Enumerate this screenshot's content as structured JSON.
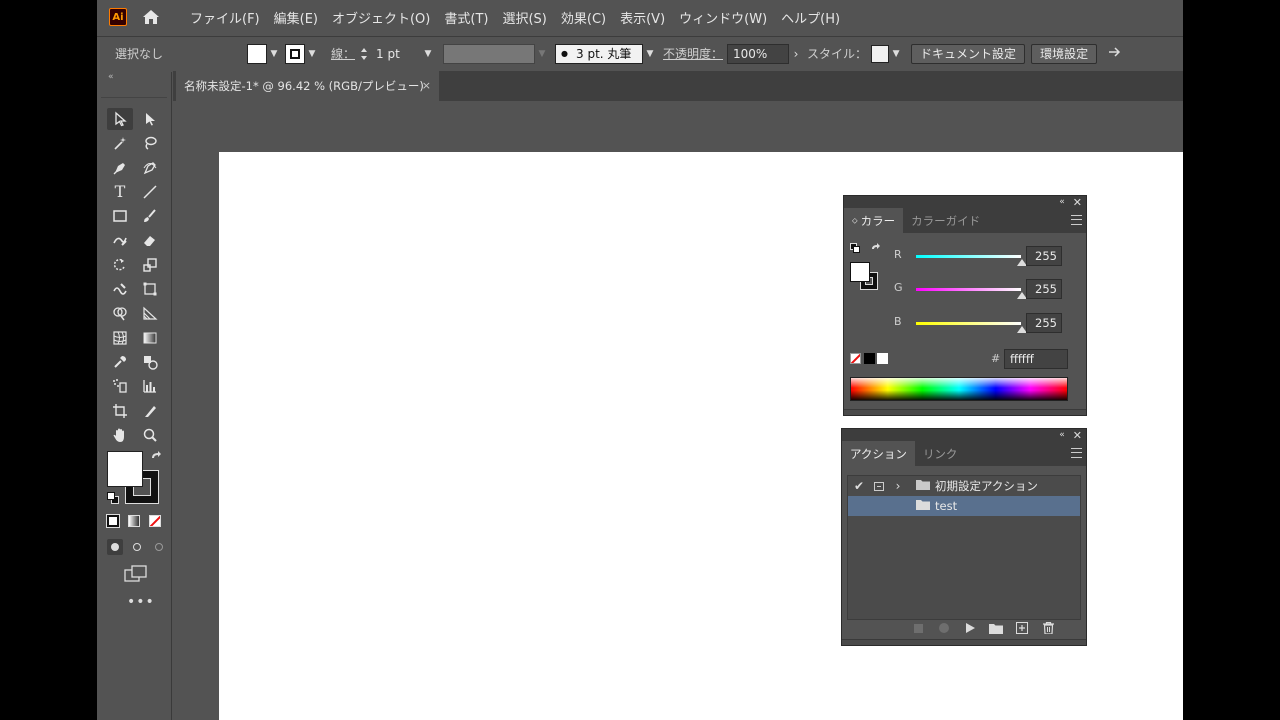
{
  "app": {
    "logo": "Ai",
    "menu": [
      "ファイル(F)",
      "編集(E)",
      "オブジェクト(O)",
      "書式(T)",
      "選択(S)",
      "効果(C)",
      "表示(V)",
      "ウィンドウ(W)",
      "ヘルプ(H)"
    ]
  },
  "control_bar": {
    "selection_label": "選択なし",
    "stroke_label": "線：",
    "stroke_weight": "1 pt",
    "brush_label": "3 pt. 丸筆",
    "opacity_label": "不透明度：",
    "opacity_value": "100%",
    "style_label": "スタイル：",
    "document_setup_button": "ドキュメント設定",
    "preferences_button": "環境設定"
  },
  "toolpanel": {
    "collapse_label": "«"
  },
  "document": {
    "tab_title": "名称未設定-1* @ 96.42 % (RGB/プレビュー)",
    "close": "×"
  },
  "color_panel": {
    "tabs": [
      "カラー",
      "カラーガイド"
    ],
    "channels": [
      {
        "label": "R",
        "value": "255"
      },
      {
        "label": "G",
        "value": "255"
      },
      {
        "label": "B",
        "value": "255"
      }
    ],
    "hash_label": "#",
    "hex_value": "ffffff"
  },
  "actions_panel": {
    "tabs": [
      "アクション",
      "リンク"
    ],
    "rows": [
      {
        "name": "初期設定アクション",
        "type": "set",
        "checked": true,
        "selected": false
      },
      {
        "name": "test",
        "type": "set",
        "checked": false,
        "selected": true
      }
    ]
  },
  "colors": {
    "ui_bg": "#535353",
    "artboard": "#ffffff",
    "selection": "#59708e",
    "accent": "#ff9a00"
  }
}
